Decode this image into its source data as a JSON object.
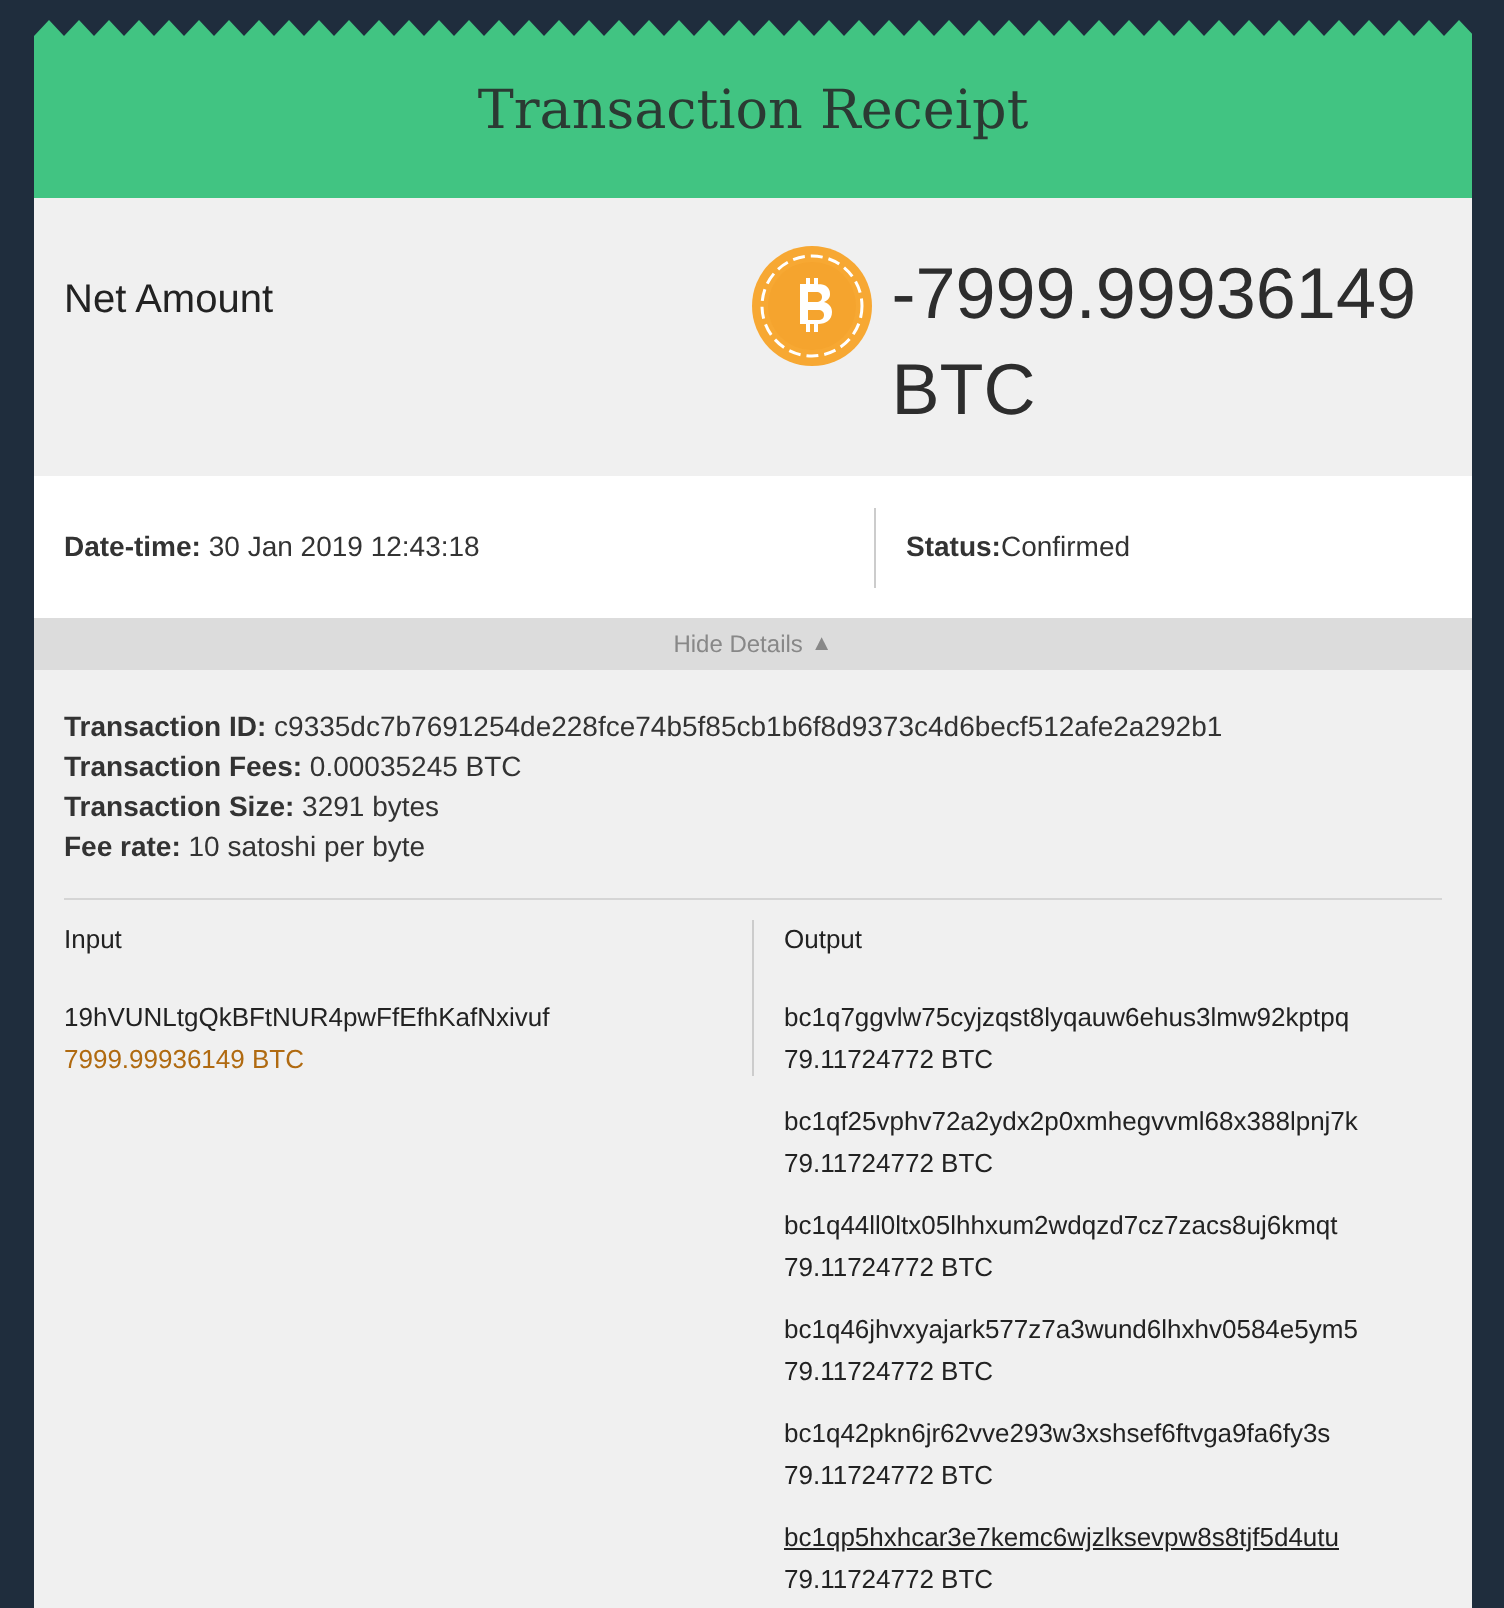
{
  "title": "Transaction Receipt",
  "net_amount": {
    "label": "Net Amount",
    "amount": "-7999.99936149",
    "unit": "BTC"
  },
  "date_time": {
    "label": "Date-time:",
    "value": "30 Jan 2019 12:43:18"
  },
  "status": {
    "label": "Status:",
    "value": "Confirmed"
  },
  "toggle": {
    "label": "Hide Details",
    "icon": "▲"
  },
  "details": [
    {
      "label": "Transaction ID:",
      "value": "c9335dc7b7691254de228fce74b5f85cb1b6f8d9373c4d6becf512afe2a292b1"
    },
    {
      "label": "Transaction Fees:",
      "value": "0.00035245 BTC"
    },
    {
      "label": "Transaction Size:",
      "value": "3291 bytes"
    },
    {
      "label": "Fee rate:",
      "value": "10 satoshi per byte"
    }
  ],
  "input": {
    "heading": "Input",
    "entries": [
      {
        "address": "19hVUNLtgQkBFtNUR4pwFfEfhKafNxivuf",
        "amount": "7999.99936149 BTC"
      }
    ]
  },
  "output": {
    "heading": "Output",
    "entries": [
      {
        "address": "bc1q7ggvlw75cyjzqst8lyqauw6ehus3lmw92kptpq",
        "amount": "79.11724772 BTC",
        "hovered": false
      },
      {
        "address": "bc1qf25vphv72a2ydx2p0xmhegvvml68x388lpnj7k",
        "amount": "79.11724772 BTC",
        "hovered": false
      },
      {
        "address": "bc1q44ll0ltx05lhhxum2wdqzd7cz7zacs8uj6kmqt",
        "amount": "79.11724772 BTC",
        "hovered": false
      },
      {
        "address": "bc1q46jhvxyajark577z7a3wund6lhxhv0584e5ym5",
        "amount": "79.11724772 BTC",
        "hovered": false
      },
      {
        "address": "bc1q42pkn6jr62vve293w3xshsef6ftvga9fa6fy3s",
        "amount": "79.11724772 BTC",
        "hovered": false
      },
      {
        "address": "bc1qp5hxhcar3e7kemc6wjzlksevpw8s8tjf5d4utu",
        "amount": "79.11724772 BTC",
        "hovered": true
      }
    ]
  }
}
